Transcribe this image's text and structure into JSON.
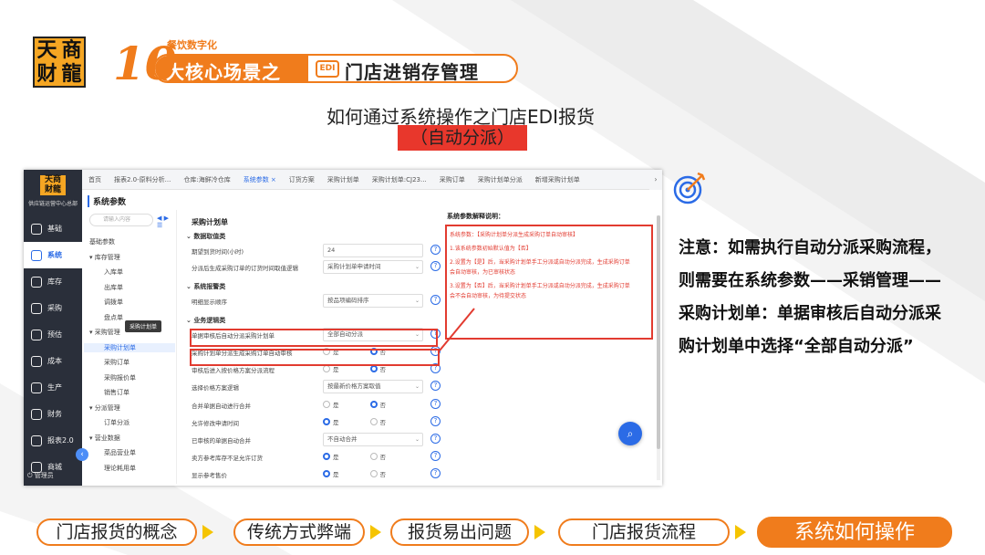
{
  "header": {
    "logo_chars": [
      "天",
      "商",
      "财",
      "龍"
    ],
    "ten": "10",
    "tagline": "餐饮数字化",
    "banner_left": "大核心场景之",
    "banner_icon": "EDI",
    "banner_right": "门店进销存管理",
    "title": "如何通过系统操作之门店EDI报货",
    "subtitle": "（自动分派）"
  },
  "app": {
    "sidebar": {
      "logo": "天商\n财龍",
      "org": "供应链运营中心总部",
      "items": [
        {
          "label": "基础",
          "icon": "base-icon",
          "active": false
        },
        {
          "label": "系统",
          "icon": "system-icon",
          "active": true
        },
        {
          "label": "库存",
          "icon": "inventory-icon",
          "active": false
        },
        {
          "label": "采购",
          "icon": "purchase-icon",
          "active": false
        },
        {
          "label": "预估",
          "icon": "forecast-icon",
          "active": false
        },
        {
          "label": "成本",
          "icon": "cost-icon",
          "active": false
        },
        {
          "label": "生产",
          "icon": "production-icon",
          "active": false
        },
        {
          "label": "财务",
          "icon": "finance-icon",
          "active": false
        },
        {
          "label": "报表2.0",
          "icon": "report-icon",
          "active": false
        },
        {
          "label": "商城",
          "icon": "mall-icon",
          "active": false
        }
      ],
      "user": "管理员"
    },
    "tabs": [
      {
        "label": "首页",
        "active": false
      },
      {
        "label": "报表2.0-原料分析...",
        "active": false
      },
      {
        "label": "仓库:海鲜冷仓库",
        "active": false
      },
      {
        "label": "系统参数 ×",
        "active": true
      },
      {
        "label": "订货方案",
        "active": false
      },
      {
        "label": "采购计划单",
        "active": false
      },
      {
        "label": "采购计划单:CJ23...",
        "active": false
      },
      {
        "label": "采购订单",
        "active": false
      },
      {
        "label": "采购计划单分派",
        "active": false
      },
      {
        "label": "新增采购计划单",
        "active": false
      }
    ],
    "page_title": "系统参数",
    "tree": {
      "search_placeholder": "请输入内容",
      "nav": "◀ ▶ ☰",
      "nodes": [
        {
          "label": "基础参数",
          "indent": 0,
          "active": false
        },
        {
          "label": "▾ 库存管理",
          "indent": 0,
          "active": false
        },
        {
          "label": "入库单",
          "indent": 1,
          "active": false
        },
        {
          "label": "出库单",
          "indent": 1,
          "active": false
        },
        {
          "label": "调拨单",
          "indent": 1,
          "active": false
        },
        {
          "label": "盘点单",
          "indent": 1,
          "active": false
        },
        {
          "label": "▾ 采购管理",
          "indent": 0,
          "active": false
        },
        {
          "label": "采购计划单",
          "indent": 1,
          "active": true
        },
        {
          "label": "采购订单",
          "indent": 1,
          "active": false
        },
        {
          "label": "采购报价单",
          "indent": 1,
          "active": false
        },
        {
          "label": "销售订单",
          "indent": 1,
          "active": false
        },
        {
          "label": "▾ 分派管理",
          "indent": 0,
          "active": false
        },
        {
          "label": "订单分派",
          "indent": 1,
          "active": false
        },
        {
          "label": "▾ 营业数据",
          "indent": 0,
          "active": false
        },
        {
          "label": "菜品营业单",
          "indent": 1,
          "active": false
        },
        {
          "label": "理论耗用单",
          "indent": 1,
          "active": false
        }
      ],
      "tooltip": "采购计划单"
    },
    "form": {
      "section": "采购计划单",
      "groups": [
        "数据取值类",
        "系统报警类",
        "业务逻辑类"
      ],
      "rows": [
        {
          "label": "期望到货时间(小时)",
          "type": "input",
          "value": "24"
        },
        {
          "label": "分派后生成采购订单的订货时间取值逻辑",
          "type": "select",
          "value": "采购计划单申请时间"
        },
        {
          "label": "明细显示顺序",
          "type": "select",
          "value": "按品项编码排序"
        },
        {
          "label": "单据审核后自动分派采购计划单",
          "type": "select",
          "value": "全部自动分派"
        },
        {
          "label": "采购计划单分派生成采购订单自动审核",
          "type": "radio",
          "value": "否"
        },
        {
          "label": "审核后进入按价格方案分派流程",
          "type": "radio",
          "value": "否"
        },
        {
          "label": "选择价格方案逻辑",
          "type": "select",
          "value": "按最新价格方案取值"
        },
        {
          "label": "合并单据自动进行合并",
          "type": "radio",
          "value": "否"
        },
        {
          "label": "允许修改申请时间",
          "type": "radio",
          "value": "是"
        },
        {
          "label": "已审核的单据自动合并",
          "type": "select",
          "value": "不自动合并"
        },
        {
          "label": "卖方参考库存不足允许订货",
          "type": "radio",
          "value": "是"
        },
        {
          "label": "显示参考售价",
          "type": "radio",
          "value": "是"
        }
      ],
      "radio_yes": "是",
      "radio_no": "否",
      "help": "?"
    },
    "info": {
      "title": "系统参数解释说明：",
      "lines": [
        "系统参数：【采购计划单分派生成采购订单自动审核】",
        "1.该系统参数初始默认值为【否】",
        "2.设置为【是】后，当采购计划单手工分派或自动分派完成，生成采购订单",
        "会自动审核，为已审核状态",
        "3.设置为【否】后，当采购计划单手工分派或自动分派完成，生成采购订单",
        "会不会自动审核，为待提交状态"
      ]
    }
  },
  "note": "注意：如需执行自动分派采购流程，则需要在系统参数——采销管理——采购计划单：单据审核后自动分派采购计划单中选择“全部自动分派”",
  "steps": [
    {
      "label": "门店报货的概念",
      "active": false
    },
    {
      "label": "传统方式弊端",
      "active": false
    },
    {
      "label": "报货易出问题",
      "active": false
    },
    {
      "label": "门店报货流程",
      "active": false
    },
    {
      "label": "系统如何操作",
      "active": true
    }
  ],
  "colors": {
    "accent": "#f07c1c",
    "red": "#e23b30",
    "blue": "#2b6be6",
    "yellow": "#f5c400"
  }
}
